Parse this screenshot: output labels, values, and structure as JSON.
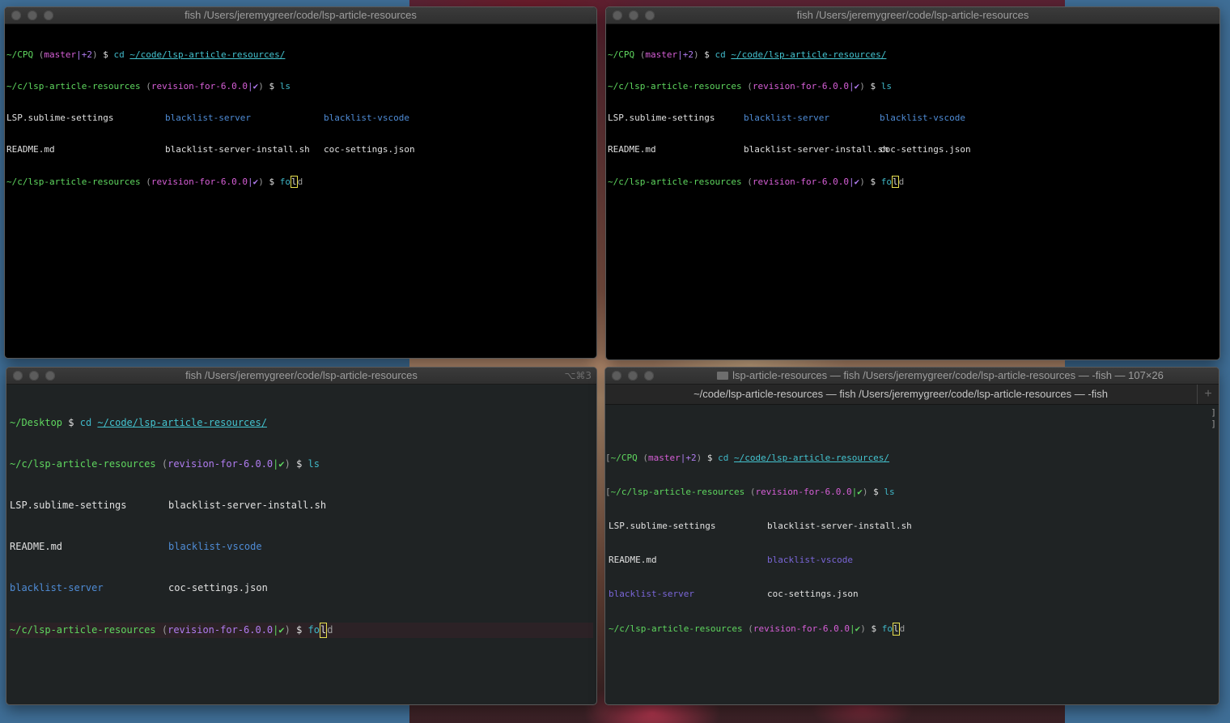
{
  "colors": {
    "prompt_path": "#5fd75f",
    "branch": "#d75fd7",
    "command": "#40b8c8",
    "directory": "#4f8cd6",
    "cursor_border": "#e8e050",
    "desktop_bg": "#3f6e96"
  },
  "windows": [
    {
      "title": "fish /Users/jeremygreer/code/lsp-article-resources",
      "line1": {
        "path": "~/CPQ",
        "open": "(",
        "branch": "master",
        "status": "|+2",
        "close": ")",
        "dollar": "$",
        "cmd": "cd",
        "arg": "~/code/lsp-article-resources/"
      },
      "line2": {
        "path": "~/c/lsp-article-resources",
        "open": "(",
        "branch": "revision-for-6.0.0",
        "status": "|✔",
        "close": ")",
        "dollar": "$",
        "cmd": "ls"
      },
      "ls": [
        [
          "LSP.sublime-settings",
          "blacklist-server",
          "blacklist-vscode"
        ],
        [
          "README.md",
          "blacklist-server-install.sh",
          "coc-settings.json"
        ]
      ],
      "line3": {
        "path": "~/c/lsp-article-resources",
        "open": "(",
        "branch": "revision-for-6.0.0",
        "status": "|✔",
        "close": ")",
        "dollar": "$",
        "typed": "fo",
        "cursor": "l",
        "rest": "d"
      }
    },
    {
      "title": "fish /Users/jeremygreer/code/lsp-article-resources",
      "line1": {
        "path": "~/CPQ",
        "open": "(",
        "branch": "master",
        "status": "|+2",
        "close": ")",
        "dollar": "$",
        "cmd": "cd",
        "arg": "~/code/lsp-article-resources/"
      },
      "line2": {
        "path": "~/c/lsp-article-resources",
        "open": "(",
        "branch": "revision-for-6.0.0",
        "status": "|✔",
        "close": ")",
        "dollar": "$",
        "cmd": "ls"
      },
      "ls": [
        [
          "LSP.sublime-settings",
          "blacklist-server",
          "blacklist-vscode"
        ],
        [
          "README.md",
          "blacklist-server-install.sh",
          "coc-settings.json"
        ]
      ],
      "line3": {
        "path": "~/c/lsp-article-resources",
        "open": "(",
        "branch": "revision-for-6.0.0",
        "status": "|✔",
        "close": ")",
        "dollar": "$",
        "typed": "fo",
        "cursor": "l",
        "rest": "d"
      }
    },
    {
      "title": "fish /Users/jeremygreer/code/lsp-article-resources",
      "shortcut": "⌥⌘3",
      "line1": {
        "path": "~/Desktop",
        "dollar": "$",
        "cmd": "cd",
        "arg": "~/code/lsp-article-resources/"
      },
      "line2": {
        "path": "~/c/lsp-article-resources",
        "open": "(",
        "branch": "revision-for-6.0.0",
        "status": "|✔",
        "close": ")",
        "dollar": "$",
        "cmd": "ls"
      },
      "ls": [
        [
          "LSP.sublime-settings",
          "blacklist-server-install.sh"
        ],
        [
          "README.md",
          "blacklist-vscode"
        ],
        [
          "blacklist-server",
          "coc-settings.json"
        ]
      ],
      "line3": {
        "path": "~/c/lsp-article-resources",
        "open": "(",
        "branch": "revision-for-6.0.0",
        "status": "|✔",
        "close": ")",
        "dollar": "$",
        "typed": "fo",
        "cursor": "l",
        "rest": "d"
      }
    },
    {
      "title": "lsp-article-resources — fish /Users/jeremygreer/code/lsp-article-resources — -fish — 107×26",
      "tab": "~/code/lsp-article-resources — fish /Users/jeremygreer/code/lsp-article-resources — -fish",
      "new_tab": "+",
      "edge_open": "[",
      "edge_close": "]",
      "line1": {
        "path": "~/CPQ",
        "open": "(",
        "branch": "master",
        "status": "|+2",
        "close": ")",
        "dollar": "$",
        "cmd": "cd",
        "arg": "~/code/lsp-article-resources/"
      },
      "line2": {
        "path": "~/c/lsp-article-resources",
        "open": "(",
        "branch": "revision-for-6.0.0",
        "status": "|✔",
        "close": ")",
        "dollar": "$",
        "cmd": "ls"
      },
      "ls": [
        [
          "LSP.sublime-settings",
          "blacklist-server-install.sh"
        ],
        [
          "README.md",
          "blacklist-vscode"
        ],
        [
          "blacklist-server",
          "coc-settings.json"
        ]
      ],
      "line3": {
        "path": "~/c/lsp-article-resources",
        "open": "(",
        "branch": "revision-for-6.0.0",
        "status": "|✔",
        "close": ")",
        "dollar": "$",
        "typed": "fo",
        "cursor": "l",
        "rest": "d"
      }
    }
  ]
}
